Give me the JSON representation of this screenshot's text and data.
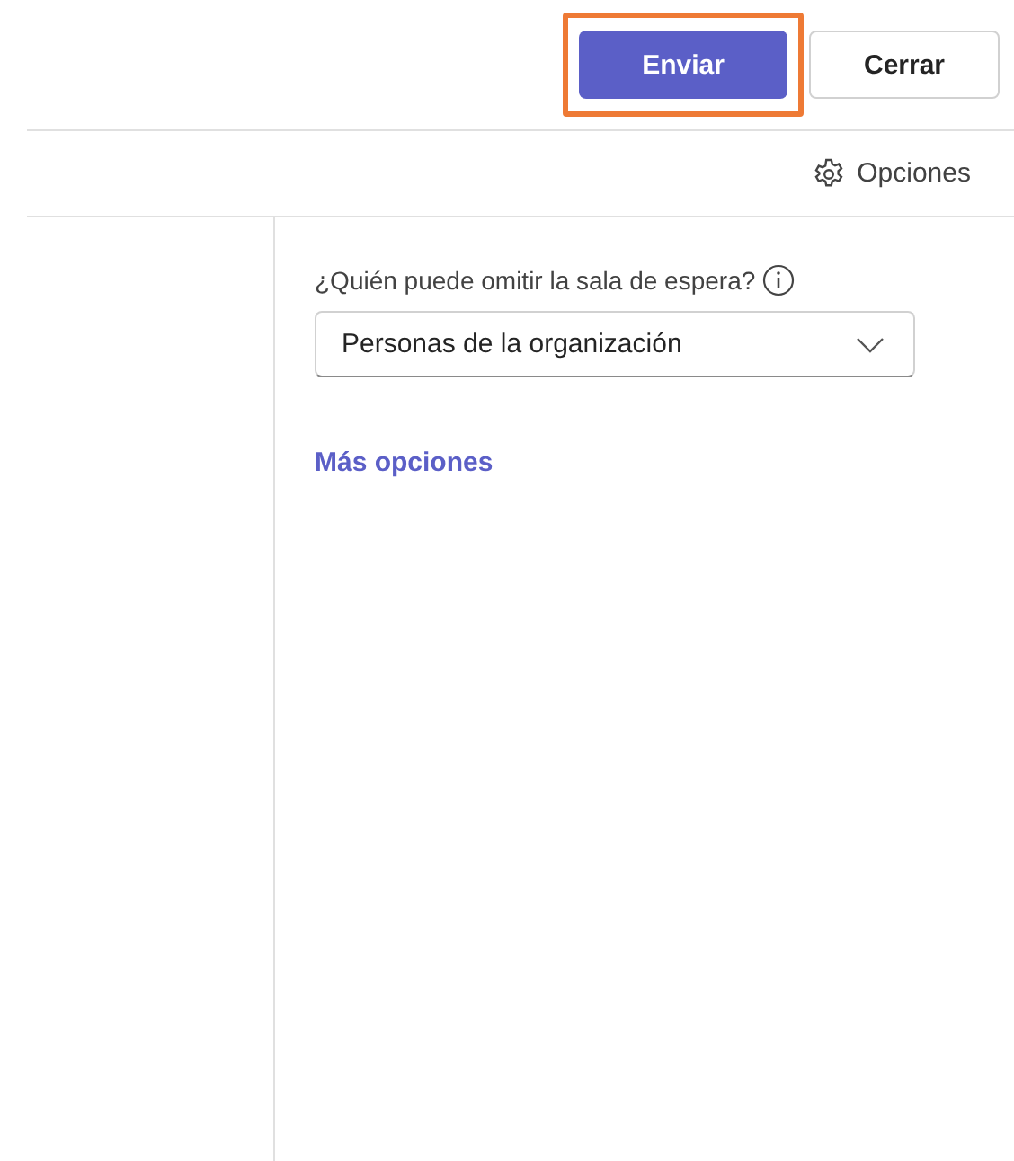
{
  "header": {
    "buttons": [
      {
        "label": "Enviar",
        "kind": "primary",
        "highlighted": true
      },
      {
        "label": "Cerrar",
        "kind": "secondary",
        "highlighted": false
      }
    ]
  },
  "toolbar": {
    "options_label": "Opciones"
  },
  "form": {
    "field_label": "¿Quién puede omitir la sala de espera?",
    "dropdown_value": "Personas de la organización",
    "more_link": "Más opciones"
  }
}
